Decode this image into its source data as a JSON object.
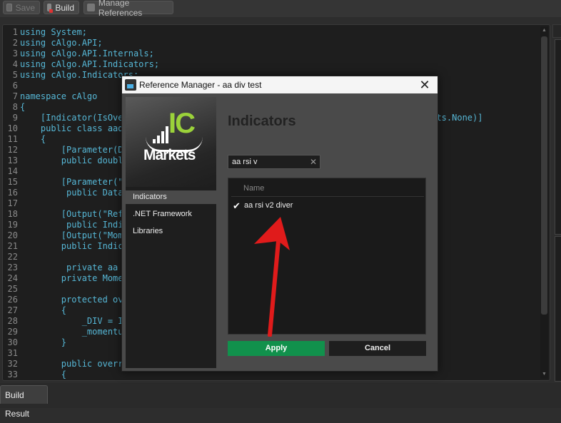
{
  "toolbar": {
    "save_label": "Save",
    "build_label": "Build",
    "refs_label": "Manage References"
  },
  "code_lines": [
    {
      "n": "1",
      "t": "using System;"
    },
    {
      "n": "2",
      "t": "using cAlgo.API;"
    },
    {
      "n": "3",
      "t": "using cAlgo.API.Internals;"
    },
    {
      "n": "4",
      "t": "using cAlgo.API.Indicators;"
    },
    {
      "n": "5",
      "t": "using cAlgo.Indicators;"
    },
    {
      "n": "6",
      "t": ""
    },
    {
      "n": "7",
      "t": "namespace cAlgo"
    },
    {
      "n": "8",
      "t": "{"
    },
    {
      "n": "9",
      "t": "    [Indicator(IsOver"
    },
    {
      "n": "10",
      "t": "    public class aadi"
    },
    {
      "n": "11",
      "t": "    {"
    },
    {
      "n": "12",
      "t": "        [Parameter(De"
    },
    {
      "n": "13",
      "t": "        public double"
    },
    {
      "n": "14",
      "t": ""
    },
    {
      "n": "15",
      "t": "        [Parameter(\""
    },
    {
      "n": "16",
      "t": "         public DataS"
    },
    {
      "n": "17",
      "t": ""
    },
    {
      "n": "18",
      "t": "        [Output(\"Refe"
    },
    {
      "n": "19",
      "t": "         public Indic"
    },
    {
      "n": "20",
      "t": "        [Output(\"Mome"
    },
    {
      "n": "21",
      "t": "        public Indica"
    },
    {
      "n": "22",
      "t": ""
    },
    {
      "n": "23",
      "t": "         private aa r"
    },
    {
      "n": "24",
      "t": "        private Momen"
    },
    {
      "n": "25",
      "t": ""
    },
    {
      "n": "26",
      "t": "        protected ove"
    },
    {
      "n": "27",
      "t": "        {"
    },
    {
      "n": "28",
      "t": "            _DIV = In"
    },
    {
      "n": "29",
      "t": "            _momentum"
    },
    {
      "n": "30",
      "t": "        }"
    },
    {
      "n": "31",
      "t": ""
    },
    {
      "n": "32",
      "t": "        public overri"
    },
    {
      "n": "33",
      "t": "        {"
    }
  ],
  "code_right_fragment": "ghts.None)]",
  "dialog": {
    "title": "Reference Manager - aa div test",
    "logo_ic": "IC",
    "logo_markets": "Markets",
    "nav": [
      "Indicators",
      ".NET Framework",
      "Libraries"
    ],
    "heading": "Indicators",
    "search_value": "aa rsi v",
    "column_name": "Name",
    "items": [
      {
        "label": "aa rsi v2 diver",
        "checked": true
      }
    ],
    "apply_label": "Apply",
    "cancel_label": "Cancel"
  },
  "bottom_tab": "Build Result",
  "colors": {
    "accent_green": "#11914c",
    "code_text": "#56b7d6",
    "arrow": "#e01b1b",
    "logo_green": "#9bd23a"
  }
}
